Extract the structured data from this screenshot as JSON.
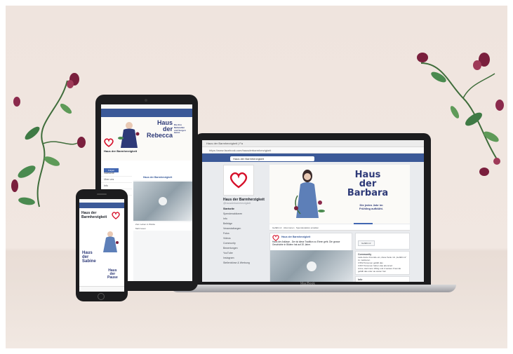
{
  "scene": {
    "background_color": "#efe4de",
    "flower_colors": [
      "#7a1f3d",
      "#8b2a4c",
      "#2f6b3c",
      "#4a8a4f"
    ]
  },
  "laptop": {
    "brand": "MacBook",
    "browser_tab": "Haus der Barmherzigkeit | Fa",
    "url": "https://www.facebook.com/hausderbarmherzigkeit",
    "search_value": "Haus der Barmherzigkeit",
    "page_name": "Haus der Barmherzigkeit",
    "page_handle": "@hausderbarmherzigkeit",
    "nav_items": [
      "Startseite",
      "Spendenaktionen",
      "Info",
      "Beiträge",
      "Veranstaltungen",
      "Fotos",
      "Videos",
      "Community",
      "Bewertungen",
      "YouTube",
      "Instagram",
      "Stellenbörse & Werbung"
    ],
    "cover_title_lines": [
      "Haus",
      "der",
      "Barbara"
    ],
    "cover_subtitle_lines": [
      "Die jeden Jahr im",
      "Frühling aufblüht."
    ],
    "actions": [
      "Gefällt mir",
      "Abonnieren",
      "Spendenaktion erstellen"
    ],
    "post_author": "Haus der Barmherzigkeit",
    "post_text": "Haus der Anlässe - Der ist diese Tradition zu Ehren geht. Die grosse Geschichte in Bildern hat auf 20 Jahre.",
    "learn_more": "Mehr lesen",
    "like_button": "Gefällt mir",
    "community_title": "Community",
    "community_lines": [
      "Lade deine Freunde ein, diese Seite mit „Gefällt mir“ zu markieren",
      "3.552 Personen gefällt das",
      "3.667 Personen haben das abonniert",
      "Anna, Herrmann Wittig und 2 weitere Freunde gefällt das oder sie waren hier"
    ],
    "info_title": "Info"
  },
  "tablet": {
    "page_name": "Haus der Barmherzigkeit",
    "cover_title_lines": [
      "Haus",
      "der",
      "Rebecca"
    ],
    "cover_subtitle_lines": [
      "Die ihre Nähstellen",
      "und Sorgen kennt."
    ],
    "nav_items": [
      "Startseite",
      "Über uns",
      "Info",
      "Beiträge"
    ],
    "post_author": "Haus der Barmherzigkeit",
    "feed_lines": [
      "Zum Leben in Würde",
      "Mehr lesen"
    ],
    "blue_button": "Folgen"
  },
  "phone": {
    "page_name_lines": [
      "Haus der",
      "Barmherzigkeit"
    ],
    "cover_title_lines": [
      "Haus",
      "der",
      "Sabine"
    ],
    "cover_title2_lines": [
      "Haus",
      "der",
      "Pause"
    ]
  }
}
